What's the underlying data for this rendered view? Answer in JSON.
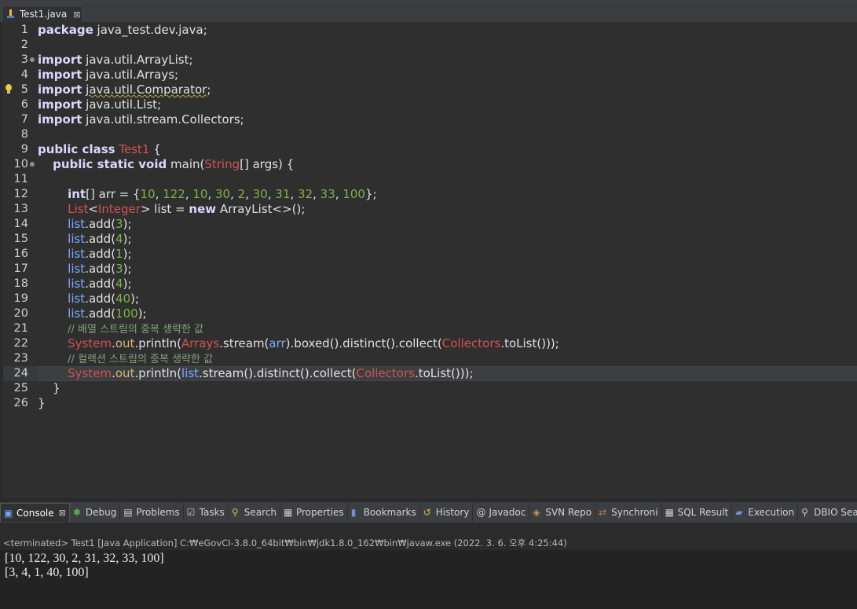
{
  "editor_tab": {
    "title": "Test1.java",
    "close": "⊠"
  },
  "code_lines": [
    {
      "n": "1",
      "html": "<span class='k'>package</span> java_test.dev.java;"
    },
    {
      "n": "2",
      "html": ""
    },
    {
      "n": "3",
      "html": "<span class='k'>import</span> java.util.ArrayList;",
      "fold": true
    },
    {
      "n": "4",
      "html": "<span class='k'>import</span> java.util.Arrays;"
    },
    {
      "n": "5",
      "html": "<span class='k'>import</span> <span class='squig'>java.util.Comparator</span>;",
      "bulb": true
    },
    {
      "n": "6",
      "html": "<span class='k'>import</span> java.util.List;"
    },
    {
      "n": "7",
      "html": "<span class='k'>import</span> java.util.stream.Collectors;"
    },
    {
      "n": "8",
      "html": ""
    },
    {
      "n": "9",
      "html": "<span class='k'>public class</span> <span class='cls'>Test1</span> {"
    },
    {
      "n": "10",
      "html": "    <span class='k'>public static void</span> main(<span class='cls'>String</span>[] args) {",
      "fold": true
    },
    {
      "n": "11",
      "html": ""
    },
    {
      "n": "12",
      "html": "        <span class='k'>int</span>[] arr = {<span class='num'>10</span>, <span class='num'>122</span>, <span class='num'>10</span>, <span class='num'>30</span>, <span class='num'>2</span>, <span class='num'>30</span>, <span class='num'>31</span>, <span class='num'>32</span>, <span class='num'>33</span>, <span class='num'>100</span>};"
    },
    {
      "n": "13",
      "html": "        <span class='cls'>List</span>&lt;<span class='cls'>Integer</span>&gt; list = <span class='k'>new</span> ArrayList&lt;&gt;();"
    },
    {
      "n": "14",
      "html": "        <span class='var'>list</span>.add(<span class='num'>3</span>);"
    },
    {
      "n": "15",
      "html": "        <span class='var'>list</span>.add(<span class='num'>4</span>);"
    },
    {
      "n": "16",
      "html": "        <span class='var'>list</span>.add(<span class='num'>1</span>);"
    },
    {
      "n": "17",
      "html": "        <span class='var'>list</span>.add(<span class='num'>3</span>);"
    },
    {
      "n": "18",
      "html": "        <span class='var'>list</span>.add(<span class='num'>4</span>);"
    },
    {
      "n": "19",
      "html": "        <span class='var'>list</span>.add(<span class='num'>40</span>);"
    },
    {
      "n": "20",
      "html": "        <span class='var'>list</span>.add(<span class='num'>100</span>);"
    },
    {
      "n": "21",
      "html": "        <span class='cmt'>// 배열 스트림의 중복 생략한 값</span>"
    },
    {
      "n": "22",
      "html": "        <span class='cls'>System</span>.<span class='fld'>out</span>.println(<span class='cls'>Arrays</span>.stream(<span class='var'>arr</span>).boxed().distinct().collect(<span class='cls'>Collectors</span>.toList()));"
    },
    {
      "n": "23",
      "html": "        <span class='cmt'>// 컬렉션 스트림의 중복 생략한 값</span>"
    },
    {
      "n": "24",
      "html": "        <span class='cls'>System</span>.<span class='fld'>out</span>.println(<span class='var'>list</span>.stream().distinct().collect(<span class='cls'>Collectors</span>.toList()));",
      "current": true
    },
    {
      "n": "25",
      "html": "    }"
    },
    {
      "n": "26",
      "html": "}"
    }
  ],
  "panel_tabs": [
    {
      "label": "Console",
      "icon": "console-icon",
      "active": true,
      "close": "⊠"
    },
    {
      "label": "Debug",
      "icon": "debug-icon"
    },
    {
      "label": "Problems",
      "icon": "problems-icon"
    },
    {
      "label": "Tasks",
      "icon": "tasks-icon"
    },
    {
      "label": "Search",
      "icon": "search-icon"
    },
    {
      "label": "Properties",
      "icon": "properties-icon"
    },
    {
      "label": "Bookmarks",
      "icon": "bookmark-icon"
    },
    {
      "label": "History",
      "icon": "history-icon"
    },
    {
      "label": "Javadoc",
      "icon": "javadoc-icon"
    },
    {
      "label": "SVN Repo",
      "icon": "svn-icon"
    },
    {
      "label": "Synchroni",
      "icon": "synchronize-icon"
    },
    {
      "label": "SQL Result",
      "icon": "sql-result-icon"
    },
    {
      "label": "Execution",
      "icon": "execution-icon"
    },
    {
      "label": "DBIO Sear",
      "icon": "dbio-search-icon"
    }
  ],
  "console": {
    "header": "<terminated> Test1 [Java Application] C:₩eGovCI-3.8.0_64bit₩bin₩jdk1.8.0_162₩bin₩javaw.exe (2022. 3. 6. 오후 4:25:44)",
    "output": [
      "[10, 122, 30, 2, 31, 32, 33, 100]",
      "[3, 4, 1, 40, 100]"
    ]
  },
  "colors": {
    "keyword": "#d8d8ff",
    "class": "#d25252",
    "number": "#7fb347",
    "variable": "#79abff",
    "comment": "#80a27b"
  }
}
